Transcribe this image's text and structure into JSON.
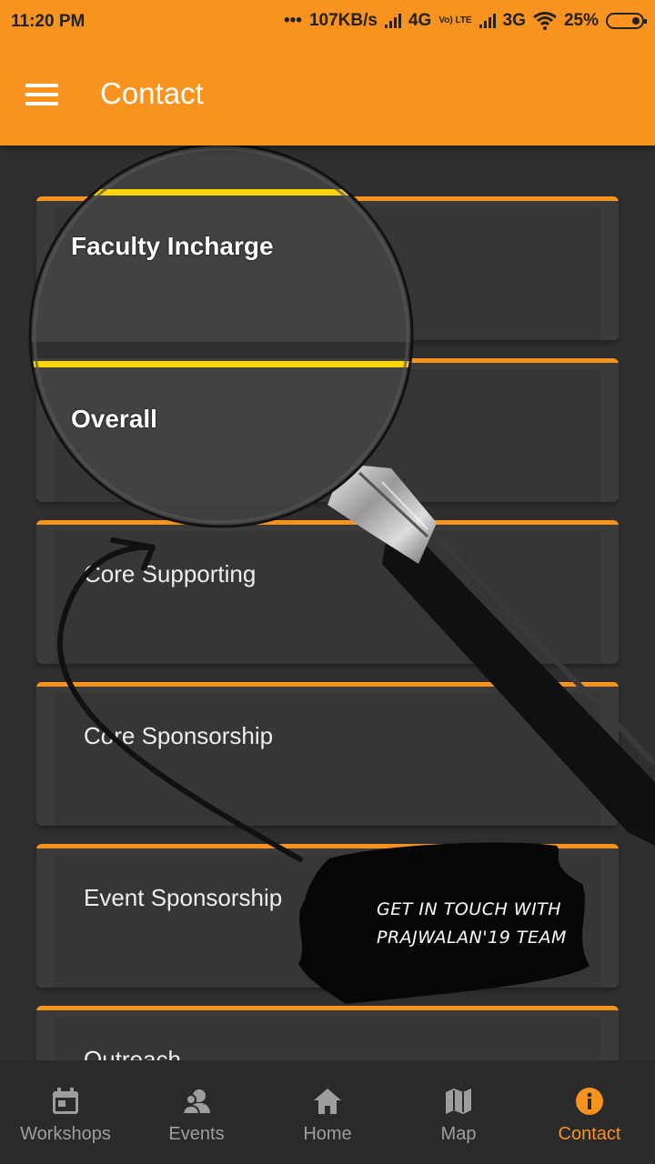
{
  "status": {
    "time": "11:20 PM",
    "dots": "•••",
    "speed": "107KB/s",
    "net1": "4G",
    "volte": "Vo) LTE",
    "net2": "3G",
    "battery": "25%"
  },
  "appbar": {
    "title": "Contact",
    "menu_icon": "hamburger-menu-icon"
  },
  "cards": [
    {
      "label": "Faculty Incharge"
    },
    {
      "label": "Overall"
    },
    {
      "label": "Core Supporting"
    },
    {
      "label": "Core Sponsorship"
    },
    {
      "label": "Event Sponsorship"
    },
    {
      "label": "Outreach"
    }
  ],
  "promo": {
    "line1": "GET IN TOUCH WITH",
    "line2": "PRAJWALAN'19 TEAM"
  },
  "bottom_nav": {
    "items": [
      {
        "label": "Workshops",
        "icon": "calendar-icon"
      },
      {
        "label": "Events",
        "icon": "people-icon"
      },
      {
        "label": "Home",
        "icon": "home-icon"
      },
      {
        "label": "Map",
        "icon": "map-icon"
      },
      {
        "label": "Contact",
        "icon": "info-icon",
        "active": true
      }
    ]
  },
  "colors": {
    "accent": "#f7931e",
    "background": "#2f2f2f",
    "card": "#3b3b3b",
    "highlight": "#ffd600"
  }
}
